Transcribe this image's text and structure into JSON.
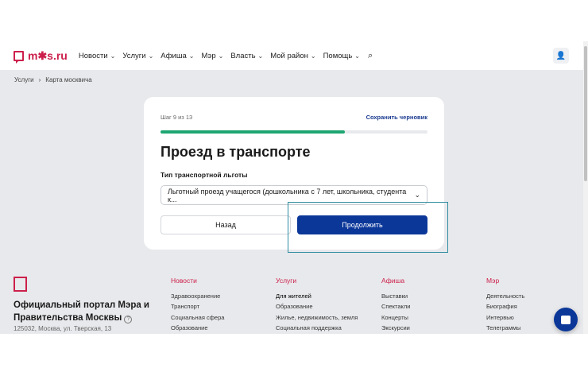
{
  "header": {
    "logo": "m✱s.ru",
    "nav": [
      "Новости",
      "Услуги",
      "Афиша",
      "Мэр",
      "Власть",
      "Мой район",
      "Помощь"
    ]
  },
  "breadcrumb": [
    "Услуги",
    "Карта москвича"
  ],
  "form": {
    "step": "Шаг 9 из 13",
    "save_draft": "Сохранить черновик",
    "progress": 0.69,
    "title": "Проезд в транспорте",
    "field_label": "Тип транспортной льготы",
    "field_value": "Льготный проезд учащегося (дошкольника с 7 лет, школьника, студента к...",
    "back": "Назад",
    "next": "Продолжить"
  },
  "footer": {
    "title": "Официальный портал Мэра и Правительства Москвы",
    "address": "125032, Москва, ул. Тверская, 13",
    "columns": [
      {
        "heading": "Новости",
        "links": [
          "Здравоохранение",
          "Транспорт",
          "Социальная сфера",
          "Образование"
        ]
      },
      {
        "heading": "Услуги",
        "links": [
          "Для жителей",
          "Образование",
          "Жилье, недвижимость, земля",
          "Социальная поддержка"
        ]
      },
      {
        "heading": "Афиша",
        "links": [
          "Выставки",
          "Спектакли",
          "Концерты",
          "Экскурсии"
        ]
      },
      {
        "heading": "Мэр",
        "links": [
          "Деятельность",
          "Биография",
          "Интервью",
          "Телеграммы"
        ]
      }
    ]
  },
  "colors": {
    "brand": "#cc1f4b",
    "primary": "#0b3799",
    "progress": "#1ea672"
  }
}
